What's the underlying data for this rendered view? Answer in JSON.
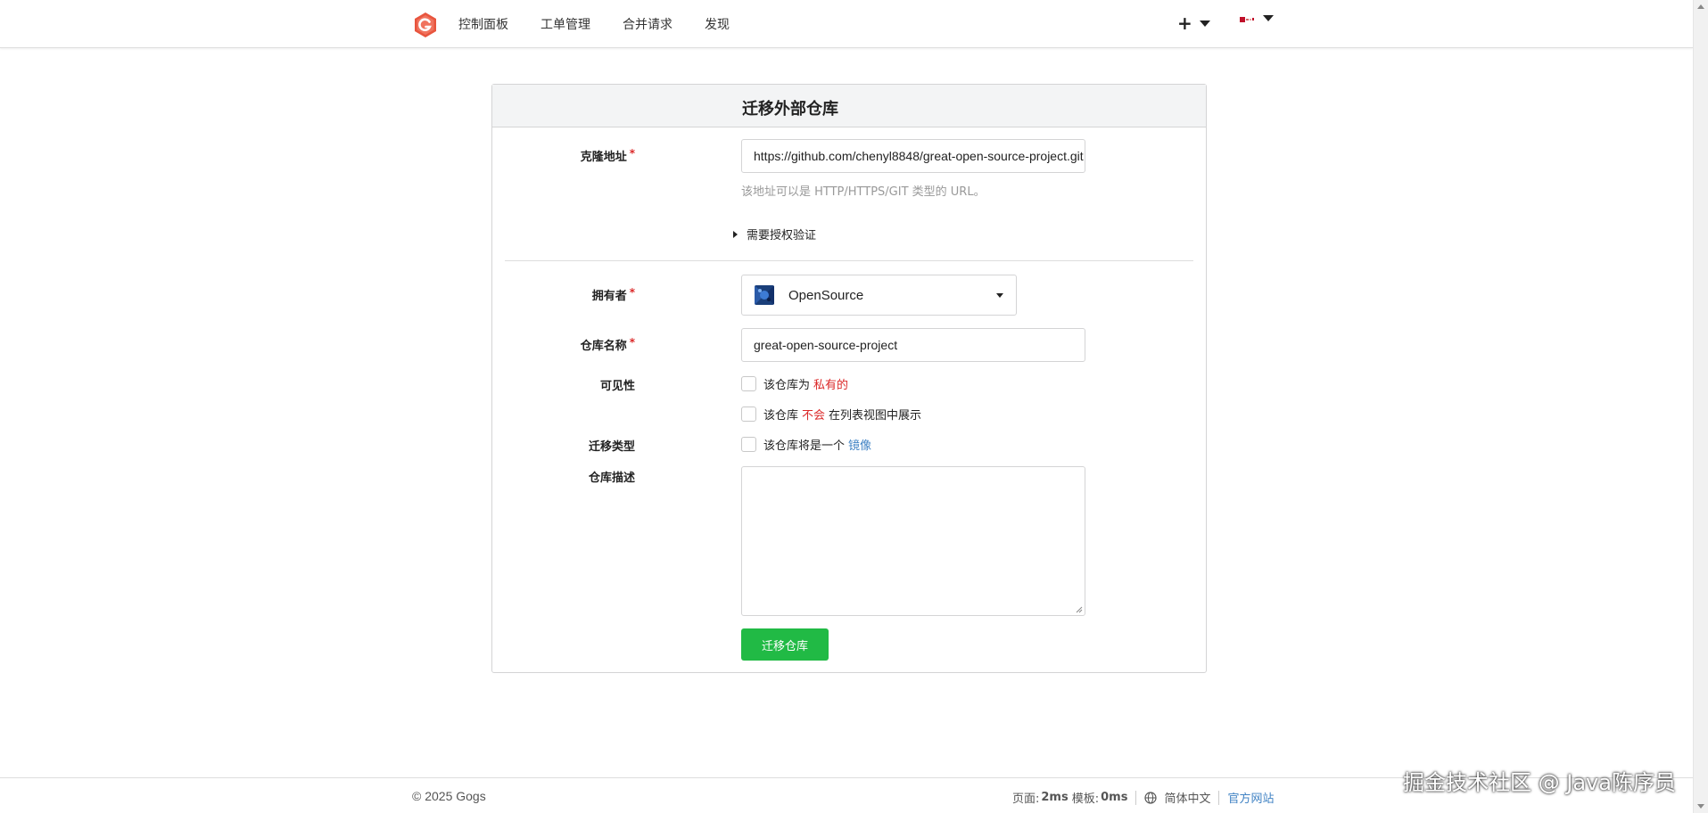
{
  "nav": {
    "logo_icon": "gogs-logo-icon",
    "items": [
      "控制面板",
      "工单管理",
      "合并请求",
      "发现"
    ],
    "create_icon": "plus-icon",
    "avatar_icon": "user-avatar-icon"
  },
  "form": {
    "title": "迁移外部仓库",
    "clone_url": {
      "label": "克隆地址",
      "required_mark": "*",
      "value": "https://github.com/chenyl8848/great-open-source-project.git",
      "help": "该地址可以是 HTTP/HTTPS/GIT 类型的 URL。"
    },
    "auth_toggle": "需要授权验证",
    "owner": {
      "label": "拥有者",
      "required_mark": "*",
      "value": "OpenSource"
    },
    "repo_name": {
      "label": "仓库名称",
      "required_mark": "*",
      "value": "great-open-source-project"
    },
    "visibility": {
      "label": "可见性",
      "private_prefix": "该仓库为",
      "private_highlight": "私有的",
      "unlisted_prefix": "该仓库",
      "unlisted_highlight": "不会",
      "unlisted_suffix": "在列表视图中展示"
    },
    "migration_type": {
      "label": "迁移类型",
      "mirror_prefix": "该仓库将是一个",
      "mirror_highlight": "镜像"
    },
    "description": {
      "label": "仓库描述",
      "value": ""
    },
    "submit": "迁移仓库"
  },
  "footer": {
    "copyright": "© 2025 Gogs",
    "page_label": "页面:",
    "page_time": "2ms",
    "template_label": "模板:",
    "template_time": "0ms",
    "language": "简体中文",
    "website": "官方网站"
  },
  "watermark": "掘金技术社区 @ Java陈序员",
  "colors": {
    "accent_green": "#21ba45",
    "required_red": "#db2828",
    "link_blue": "#4183c4"
  }
}
